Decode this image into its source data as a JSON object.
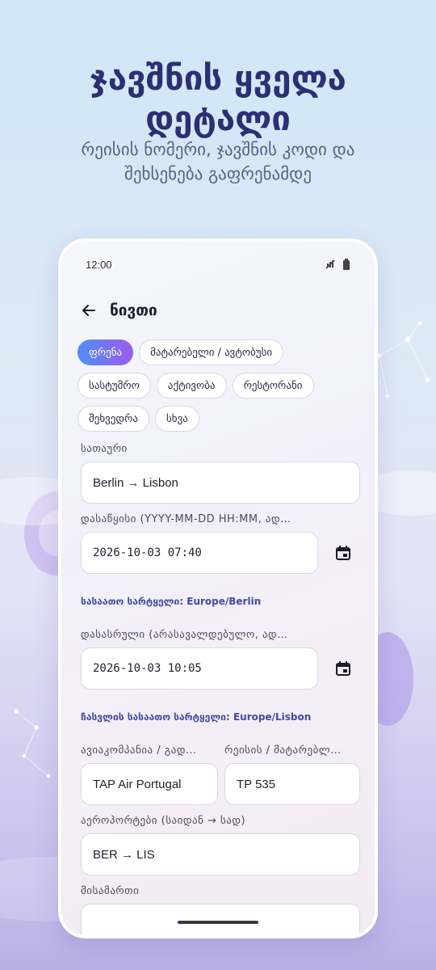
{
  "promo": {
    "headline_line1": "ჯავშნის ყველა",
    "headline_line2": "დეტალი",
    "subline_line1": "რეისის ნომერი, ჯავშნის კოდი და",
    "subline_line2": "შეხსენება გაფრენამდე"
  },
  "status_bar": {
    "time": "12:00",
    "icons": [
      "signal-icon",
      "battery-icon"
    ]
  },
  "app_bar": {
    "back_icon": "arrow-left-icon",
    "title": "ნივთი"
  },
  "categories": {
    "selected": "ფრენა",
    "rows": [
      [
        "ფრენა",
        "მატარებელი / ავტობუსი"
      ],
      [
        "სასტუმრო",
        "აქტივობა",
        "რესტორანი"
      ],
      [
        "შეხვედრა",
        "სხვა"
      ]
    ]
  },
  "form": {
    "title_label": "სათაური",
    "title_value": "Berlin → Lisbon",
    "start_label": "დასაწყისი (YYYY-MM-DD HH:MM, ად…",
    "start_value": "2026-10-03 07:40",
    "start_timezone": "სასაათო სარტყელი: Europe/Berlin",
    "end_label": "დასასრული (არასავალდებულო, ად…",
    "end_value": "2026-10-03 10:05",
    "end_timezone": "ჩასვლის სასაათო სარტყელი: Europe/Lisbon",
    "airline_label": "ავიაკომპანია / გად…",
    "airline_value": "TAP Air Portugal",
    "flight_label": "რეისის / მატარებლ…",
    "flight_value": "TP 535",
    "airports_label": "აეროპორტები (საიდან → სად)",
    "airports_value": "BER → LIS",
    "address_label": "მისამართი",
    "address_value": ""
  },
  "colors": {
    "accent_start": "#4f8ef6",
    "accent_end": "#9b5cf0",
    "headline": "#2c2f73",
    "timezone_note": "#3f4aa6"
  }
}
